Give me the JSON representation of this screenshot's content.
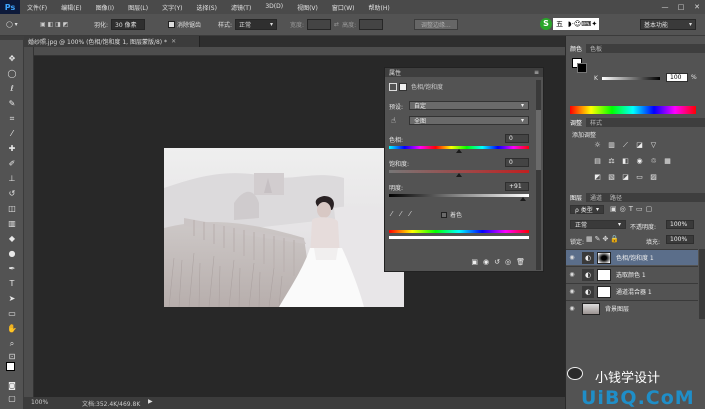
{
  "app": {
    "logo": "Ps"
  },
  "menu": [
    "文件(F)",
    "编辑(E)",
    "图像(I)",
    "图层(L)",
    "文字(Y)",
    "选择(S)",
    "滤镜(T)",
    "3D(D)",
    "视图(V)",
    "窗口(W)",
    "帮助(H)"
  ],
  "window_controls": [
    "—",
    "□",
    "✕"
  ],
  "options": {
    "feather_label": "羽化:",
    "feather_value": "30 像素",
    "antialias_label": "消除锯齿",
    "style_label": "样式:",
    "style_value": "正常",
    "width_label": "宽度:",
    "height_label": "高度:",
    "refine_edge": "调整边缘...",
    "workspace": "基本功能",
    "ime_text": "五"
  },
  "document": {
    "tab_title": "婚纱照.jpg @ 100% (色相/饱和度 1, 图层蒙版/8) *",
    "zoom": "100%",
    "doc_size": "文档:352.4K/469.8K"
  },
  "properties": {
    "header": "属性",
    "title": "色相/饱和度",
    "preset_label": "预设:",
    "preset_value": "自定",
    "channel_value": "全图",
    "hue_label": "色相:",
    "hue_value": "0",
    "saturation_label": "饱和度:",
    "saturation_value": "0",
    "lightness_label": "明度:",
    "lightness_value": "+91",
    "colorize_label": "着色"
  },
  "color_panel": {
    "tabs": [
      "颜色",
      "色板"
    ],
    "k_label": "K",
    "k_value": "100",
    "pct": "%"
  },
  "adjustments_panel": {
    "tabs": [
      "调整",
      "样式"
    ],
    "add_label": "添加调整"
  },
  "layers_panel": {
    "tabs": [
      "图层",
      "通道",
      "路径"
    ],
    "kind_label": "ρ 类型",
    "blend_mode": "正常",
    "opacity_label": "不透明度:",
    "opacity_value": "100%",
    "lock_label": "锁定:",
    "fill_label": "填充:",
    "fill_value": "100%",
    "layers": [
      {
        "name": "色相/饱和度 1",
        "selected": true
      },
      {
        "name": "选取颜色 1",
        "selected": false
      },
      {
        "name": "通道混合器 1",
        "selected": false
      },
      {
        "name": "背景图层",
        "selected": false
      }
    ]
  },
  "watermark": {
    "text": "小钱学设计",
    "brand": "UiBQ.CoM"
  },
  "colors": {
    "accent": "#3fa6ff",
    "panel_bg": "#535353",
    "selected_layer": "#5b6e8a"
  }
}
